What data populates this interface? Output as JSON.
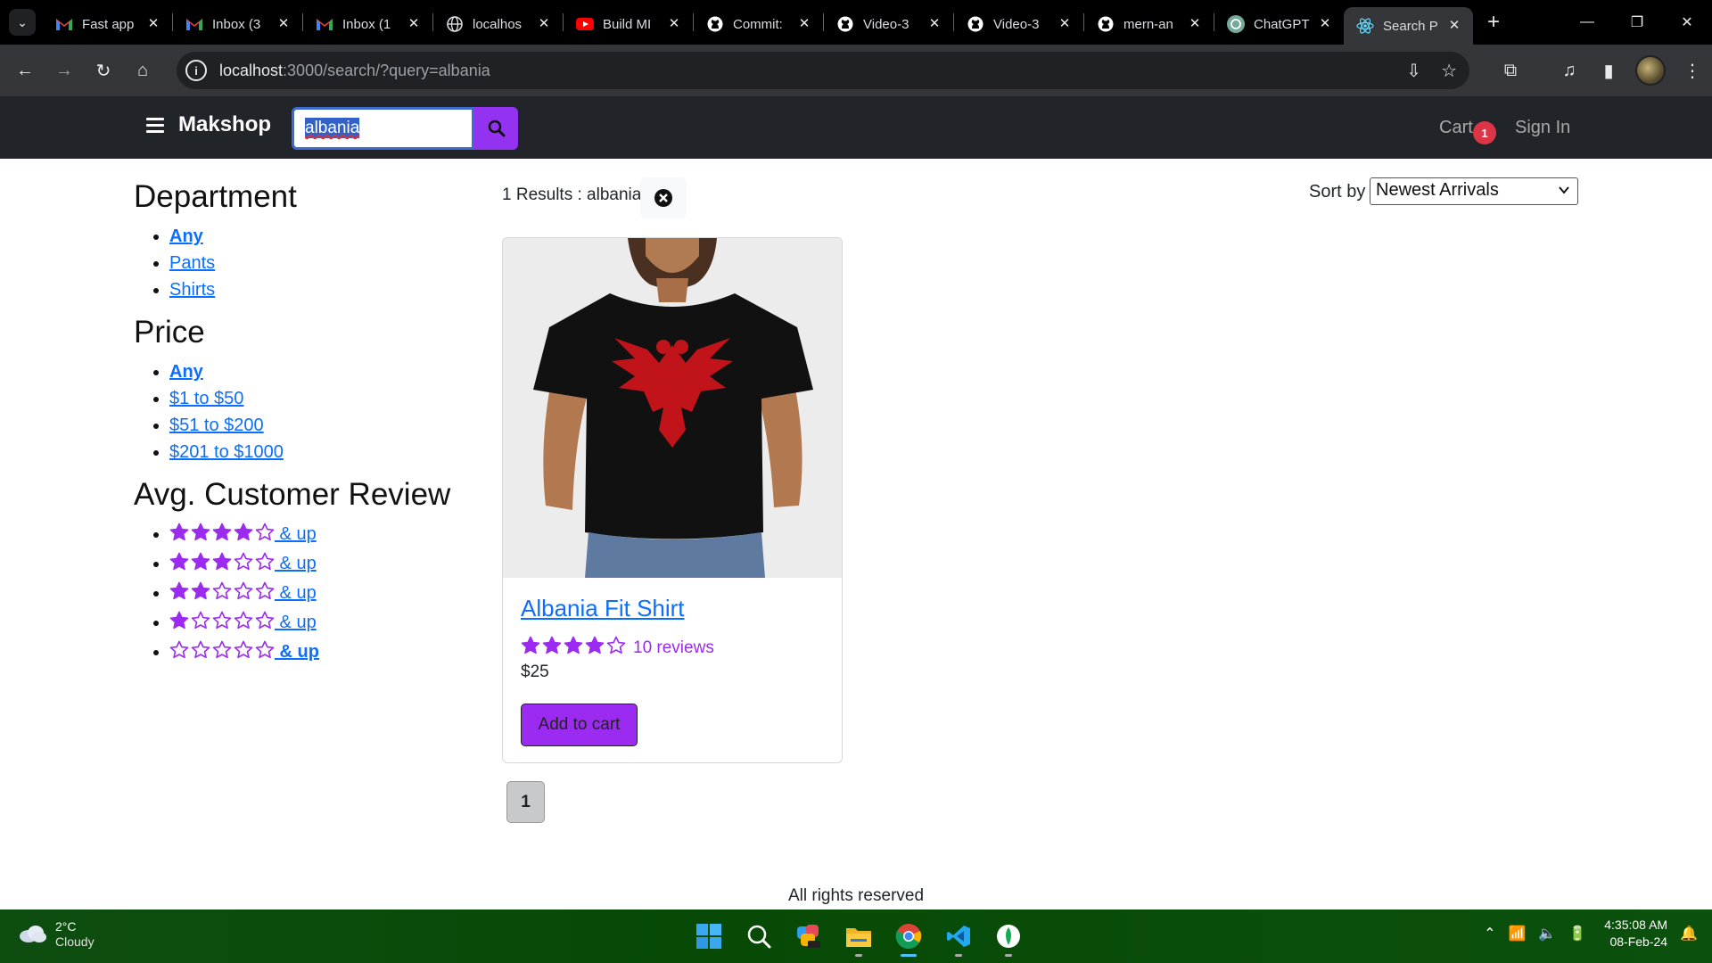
{
  "browser": {
    "tabs": [
      {
        "title": "Fast app",
        "icon": "gmail-icon",
        "active": false
      },
      {
        "title": "Inbox (3",
        "icon": "gmail-icon",
        "active": false
      },
      {
        "title": "Inbox (1",
        "icon": "gmail-icon",
        "active": false
      },
      {
        "title": "localhos",
        "icon": "globe-icon",
        "active": false
      },
      {
        "title": "Build MI",
        "icon": "youtube-icon",
        "active": false
      },
      {
        "title": "Commit:",
        "icon": "github-icon",
        "active": false
      },
      {
        "title": "Video-3",
        "icon": "github-icon",
        "active": false
      },
      {
        "title": "Video-3",
        "icon": "github-icon",
        "active": false
      },
      {
        "title": "mern-an",
        "icon": "github-icon",
        "active": false
      },
      {
        "title": "ChatGPT",
        "icon": "chatgpt-icon",
        "active": false
      },
      {
        "title": "Search P",
        "icon": "react-icon",
        "active": true
      }
    ],
    "url_host": "localhost",
    "url_rest": ":3000/search/?query=albania"
  },
  "site": {
    "brand": "Makshop",
    "search_value": "albania",
    "cart_label": "Cart",
    "cart_count": "1",
    "signin_label": "Sign In"
  },
  "sidebar": {
    "department_title": "Department",
    "departments": [
      "Any",
      "Pants",
      "Shirts"
    ],
    "price_title": "Price",
    "prices": [
      "Any",
      "$1 to $50",
      "$51 to $200",
      "$201 to $1000"
    ],
    "review_title": "Avg. Customer Review",
    "review_suffix": " & up",
    "reviews": [
      4,
      3,
      2,
      1,
      0
    ]
  },
  "results": {
    "summary": "1 Results : albania",
    "sort_label": "Sort by",
    "sort_value": "Newest Arrivals"
  },
  "product": {
    "name": "Albania Fit Shirt",
    "rating": 4,
    "reviews": "10 reviews",
    "price": "$25",
    "add_label": "Add to cart"
  },
  "pagination": {
    "current": "1"
  },
  "footer": {
    "text": "All rights reserved"
  },
  "taskbar": {
    "temp": "2°C",
    "condition": "Cloudy",
    "time": "4:35:08 AM",
    "date": "08-Feb-24"
  },
  "colors": {
    "accent": "#9b2bf0",
    "navbar": "#212529",
    "link": "#0d6efd",
    "badge": "#dc3545"
  }
}
